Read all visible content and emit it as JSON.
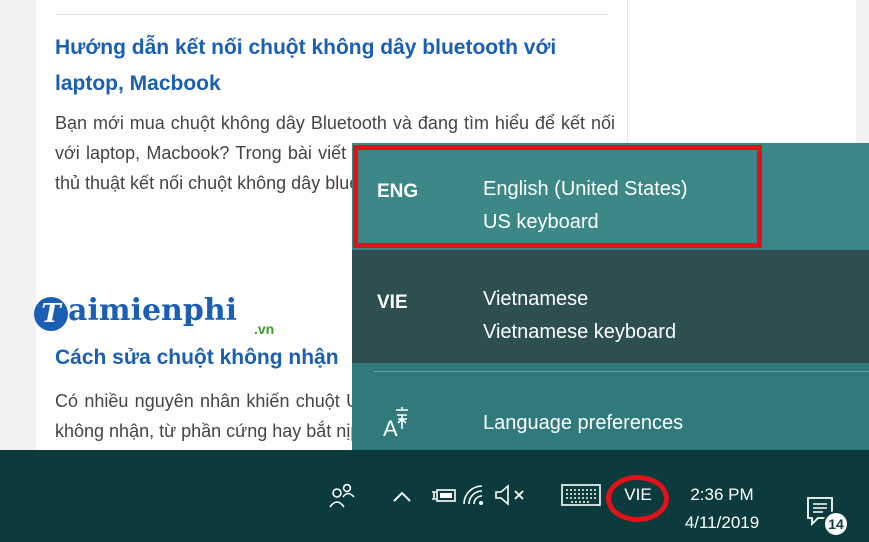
{
  "articles": [
    {
      "title": "Hướng dẫn kết nối chuột không dây bluetooth với laptop, Macbook",
      "body": "Bạn mới mua chuột không dây Bluetooth và đang tìm hiểu để kết nối với laptop, Macbook? Trong bài viết này chúng tôi sẽ chia sẻ tới bạn thủ thuật kết nối chuột không dây bluetooth với laptop, Macbook"
    },
    {
      "title": "Cách sửa chuột không nhận",
      "body": "Có nhiều nguyên nhân khiến chuột USB bị đơ, không hoạt động hay không nhận, từ phần cứng hay bắt nịp... bạn"
    }
  ],
  "watermark": {
    "brand": "aimienphi",
    "initial": "T",
    "suffix": ".vn"
  },
  "language_flyout": {
    "items": [
      {
        "code": "ENG",
        "name": "English (United States)",
        "keyboard": "US keyboard",
        "highlighted": true
      },
      {
        "code": "VIE",
        "name": "Vietnamese",
        "keyboard": "Vietnamese keyboard",
        "selected": true
      }
    ],
    "preferences_label": "Language preferences",
    "preferences_icon": "language-preferences-icon"
  },
  "taskbar": {
    "input_indicator": "VIE",
    "time": "2:36 PM",
    "date": "4/11/2019",
    "notification_count": "14",
    "icons": [
      "people-icon",
      "chevron-up-icon",
      "battery-icon",
      "wifi-icon",
      "volume-muted-icon",
      "touch-keyboard-icon",
      "notification-icon"
    ]
  },
  "colors": {
    "flyout_bg": "#317a7b",
    "highlight_item_bg": "#3b8887",
    "selected_item_bg": "#2d4f50",
    "taskbar_bg": "#0b3b3c",
    "annotation_red": "#e0121a",
    "link_blue": "#1a5fb4"
  }
}
